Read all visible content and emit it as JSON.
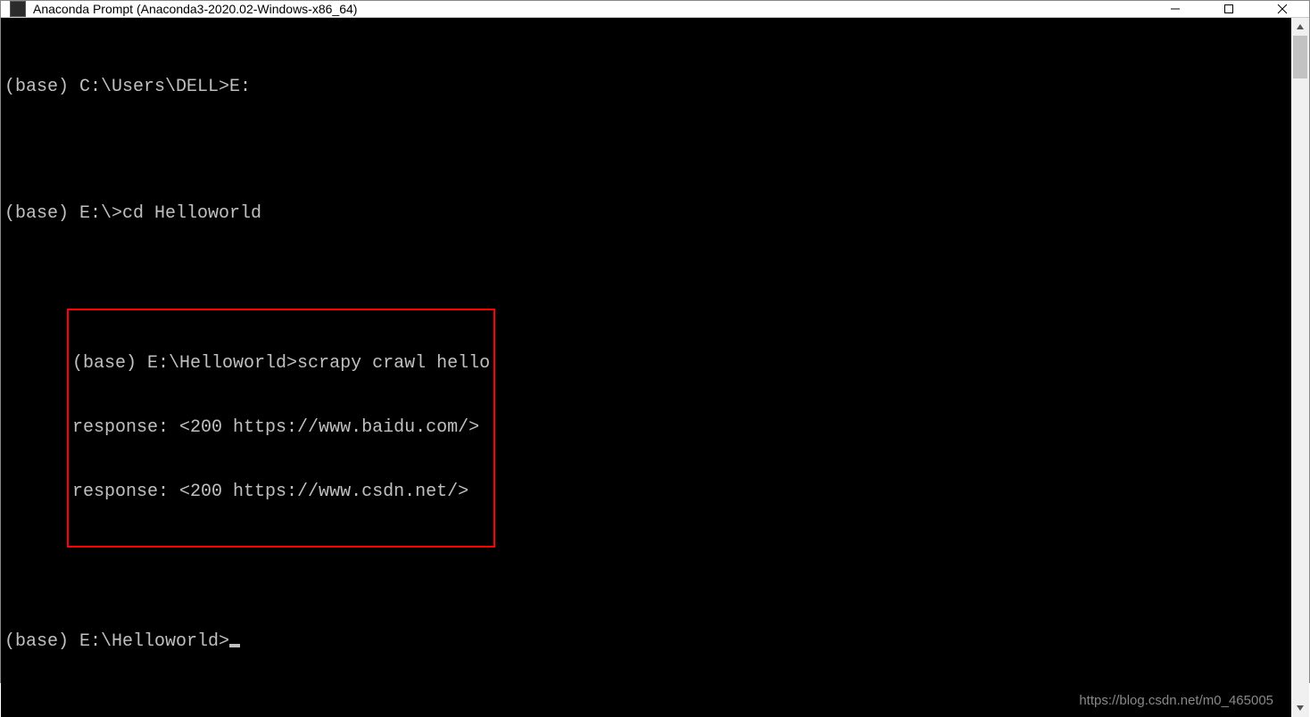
{
  "window": {
    "title": "Anaconda Prompt (Anaconda3-2020.02-Windows-x86_64)"
  },
  "terminal": {
    "lines": {
      "l1": "(base) C:\\Users\\DELL>E:",
      "l2": "(base) E:\\>cd Helloworld",
      "l3": "(base) E:\\Helloworld>scrapy crawl hello",
      "l4": "response: <200 https://www.baidu.com/>",
      "l5": "response: <200 https://www.csdn.net/>",
      "l6": "(base) E:\\Helloworld>"
    }
  },
  "watermark": "https://blog.csdn.net/m0_465005"
}
